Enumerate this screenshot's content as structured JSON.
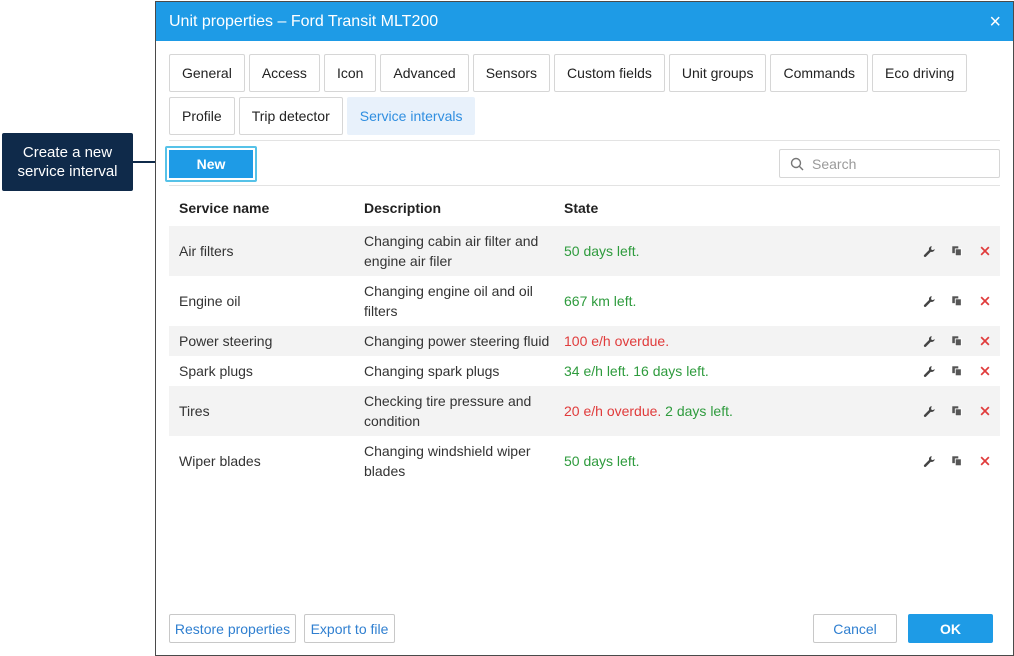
{
  "callout": {
    "line1": "Create a new",
    "line2": "service interval"
  },
  "dialog": {
    "title": "Unit properties – Ford Transit MLT200",
    "close": "×"
  },
  "tabs": {
    "row1": [
      "General",
      "Access",
      "Icon",
      "Advanced",
      "Sensors",
      "Custom fields",
      "Unit groups",
      "Commands",
      "Eco driving"
    ],
    "row2": [
      "Profile",
      "Trip detector",
      "Service intervals"
    ],
    "active": "Service intervals"
  },
  "toolbar": {
    "new_label": "New",
    "search_placeholder": "Search"
  },
  "table": {
    "headers": {
      "name": "Service name",
      "description": "Description",
      "state": "State"
    },
    "rows": [
      {
        "name": "Air filters",
        "description": "Changing cabin air filter and engine air filer",
        "state_parts": [
          {
            "text": "50 days left.",
            "status": "ok"
          }
        ]
      },
      {
        "name": "Engine oil",
        "description": "Changing engine oil and oil filters",
        "state_parts": [
          {
            "text": "667 km left.",
            "status": "ok"
          }
        ]
      },
      {
        "name": "Power steering",
        "description": "Changing power steering fluid",
        "state_parts": [
          {
            "text": "100 e/h overdue.",
            "status": "overdue"
          }
        ]
      },
      {
        "name": "Spark plugs",
        "description": "Changing spark plugs",
        "state_parts": [
          {
            "text": "34 e/h left. 16 days left.",
            "status": "ok"
          }
        ]
      },
      {
        "name": "Tires",
        "description": "Checking tire pressure and condition",
        "state_parts": [
          {
            "text": "20 e/h overdue.",
            "status": "overdue"
          },
          {
            "text": " 2 days left.",
            "status": "ok"
          }
        ]
      },
      {
        "name": "Wiper blades",
        "description": "Changing windshield wiper blades",
        "state_parts": [
          {
            "text": "50 days left.",
            "status": "ok"
          }
        ]
      }
    ],
    "row_actions": [
      "wrench-icon",
      "copy-icon",
      "delete-icon"
    ]
  },
  "footer": {
    "restore_label": "Restore properties",
    "export_label": "Export to file",
    "cancel_label": "Cancel",
    "ok_label": "OK"
  },
  "colors": {
    "accent": "#1e9be6",
    "ok": "#2e9b3d",
    "overdue": "#e03b3b",
    "callout_bg": "#0f2a4a"
  }
}
